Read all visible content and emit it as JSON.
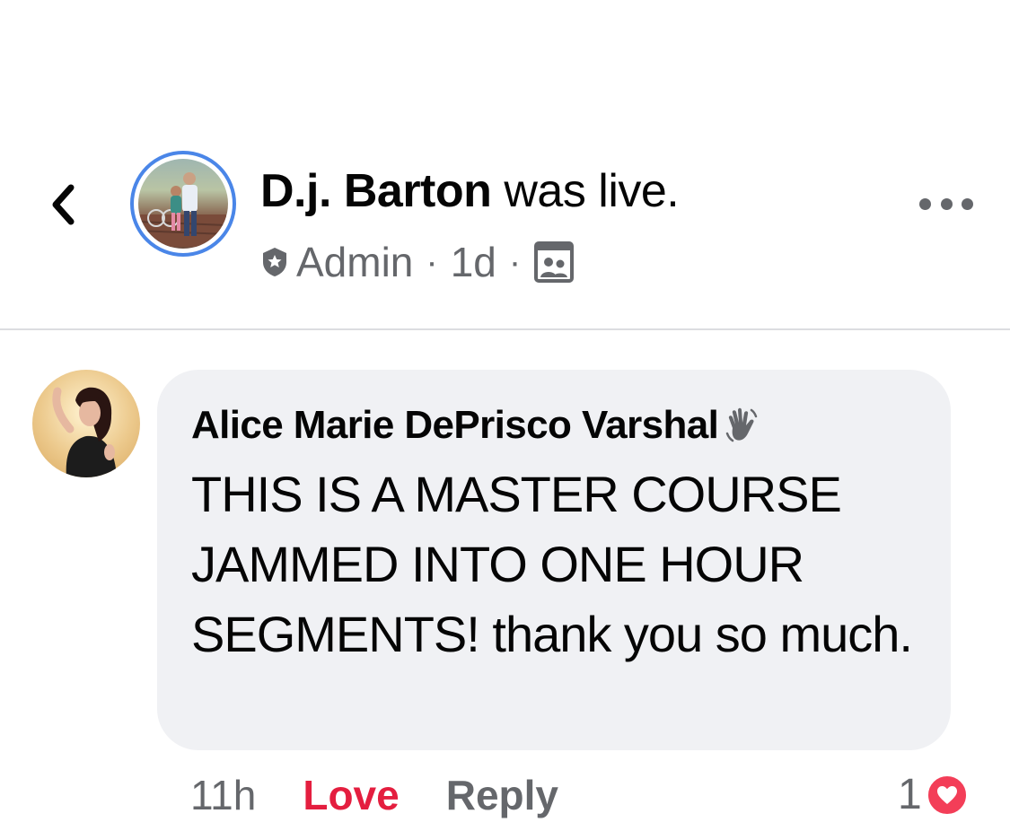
{
  "header": {
    "author_name": "D.j. Barton",
    "title_suffix": " was live.",
    "role": "Admin",
    "time": "1d",
    "separator": "·",
    "audience_icon": "group-photo-icon",
    "more_icon": "more-horizontal-icon",
    "back_icon": "chevron-left-icon",
    "avatar_ring_color": "#4a86e8"
  },
  "comment": {
    "author": "Alice Marie DePrisco Varshal",
    "badge_icon": "waving-hand-icon",
    "text": "THIS IS A MASTER COURSE JAMMED INTO ONE HOUR SEGMENTS! thank you so much.",
    "time": "11h",
    "reaction_label": "Love",
    "reply_label": "Reply",
    "reaction_count": "1",
    "reaction_icon": "heart-icon",
    "love_color": "#e41e3f"
  }
}
